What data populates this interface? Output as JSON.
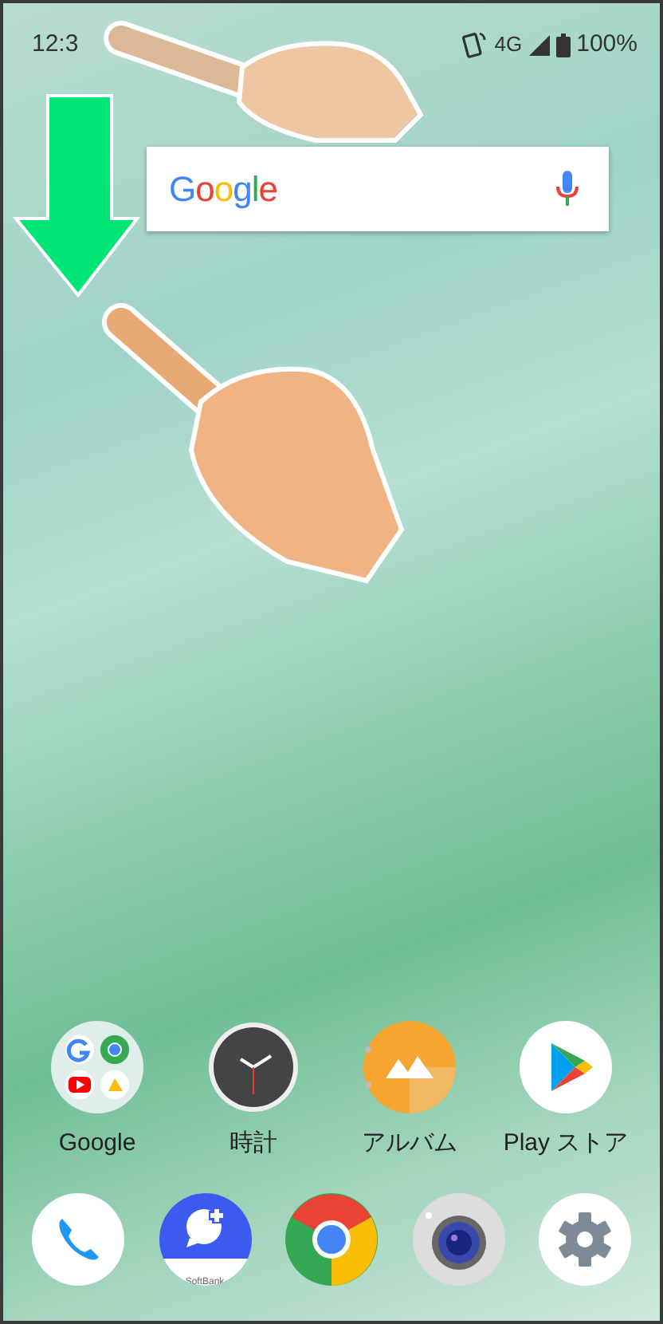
{
  "status_bar": {
    "time": "12:3",
    "network": "4G",
    "battery": "100%"
  },
  "search_bar": {
    "logo": "Google"
  },
  "apps": [
    {
      "label": "Google",
      "kind": "folder"
    },
    {
      "label": "時計",
      "kind": "clock"
    },
    {
      "label": "アルバム",
      "kind": "album"
    },
    {
      "label": "Play ストア",
      "kind": "play"
    }
  ],
  "dock": [
    {
      "kind": "phone"
    },
    {
      "kind": "message",
      "caption": "SoftBank"
    },
    {
      "kind": "chrome"
    },
    {
      "kind": "camera"
    },
    {
      "kind": "settings"
    }
  ]
}
